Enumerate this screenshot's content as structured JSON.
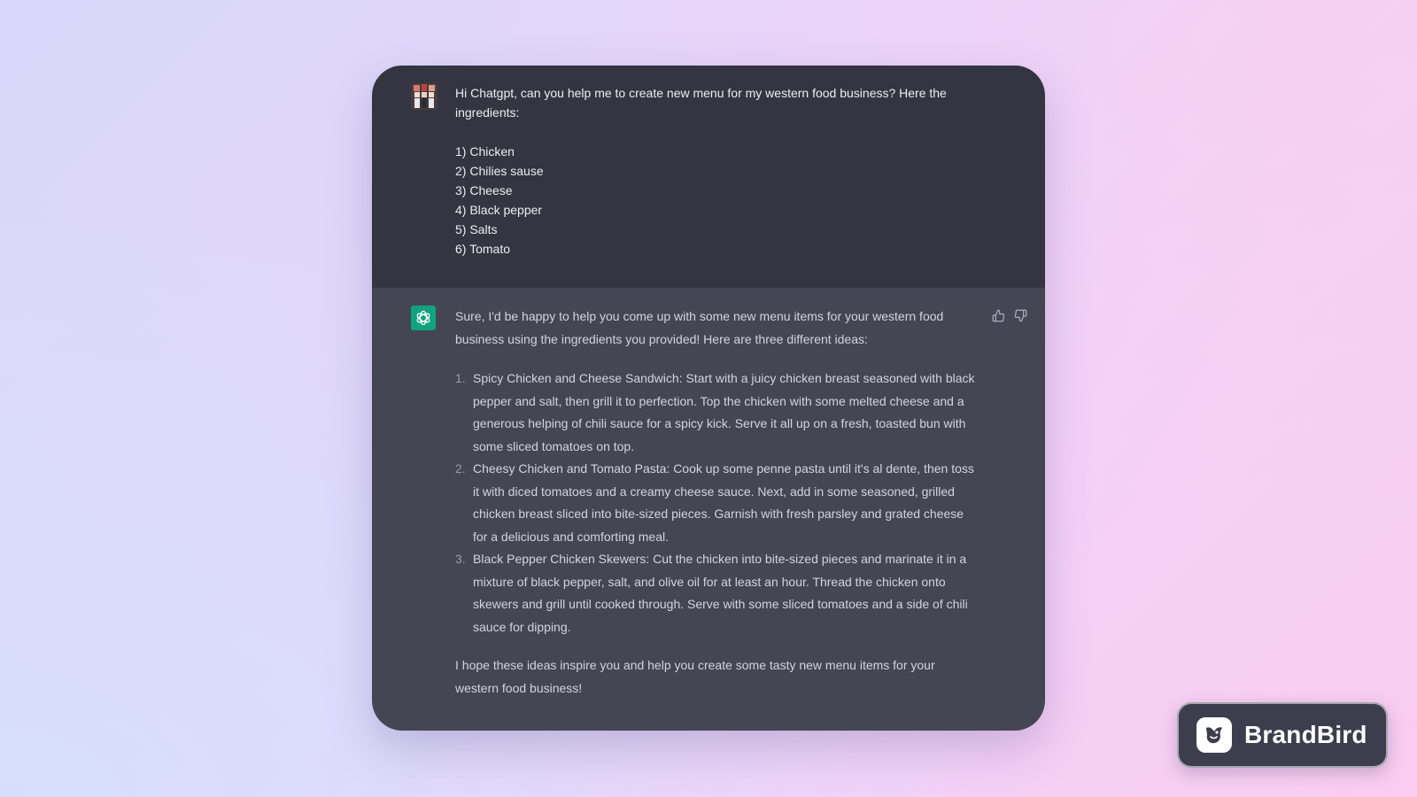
{
  "user_message": {
    "intro": "Hi Chatgpt, can you help me to create new menu for my western food business? Here the ingredients:",
    "ingredients": [
      "1) Chicken",
      "2) Chilies sause",
      "3) Cheese",
      "4) Black pepper",
      "5) Salts",
      "6) Tomato"
    ]
  },
  "assistant_message": {
    "intro": "Sure, I'd be happy to help you come up with some new menu items for your western food business using the ingredients you provided! Here are three different ideas:",
    "ideas": [
      {
        "number": "1.",
        "text": "Spicy Chicken and Cheese Sandwich: Start with a juicy chicken breast seasoned with black pepper and salt, then grill it to perfection. Top the chicken with some melted cheese and a generous helping of chili sauce for a spicy kick. Serve it all up on a fresh, toasted bun with some sliced tomatoes on top."
      },
      {
        "number": "2.",
        "text": "Cheesy Chicken and Tomato Pasta: Cook up some penne pasta until it's al dente, then toss it with diced tomatoes and a creamy cheese sauce. Next, add in some seasoned, grilled chicken breast sliced into bite-sized pieces. Garnish with fresh parsley and grated cheese for a delicious and comforting meal."
      },
      {
        "number": "3.",
        "text": "Black Pepper Chicken Skewers: Cut the chicken into bite-sized pieces and marinate it in a mixture of black pepper, salt, and olive oil for at least an hour. Thread the chicken onto skewers and grill until cooked through. Serve with some sliced tomatoes and a side of chili sauce for dipping."
      }
    ],
    "outro": "I hope these ideas inspire you and help you create some tasty new menu items for your western food business!"
  },
  "feedback": {
    "thumbs_up_icon": "thumbs-up-icon",
    "thumbs_down_icon": "thumbs-down-icon"
  },
  "brand": {
    "name": "BrandBird",
    "icon": "brandbird-logo-icon"
  },
  "colors": {
    "user_bg": "#343541",
    "assistant_bg": "#444654",
    "bot_avatar": "#10a37f",
    "badge_bg": "#3d3d4d"
  }
}
